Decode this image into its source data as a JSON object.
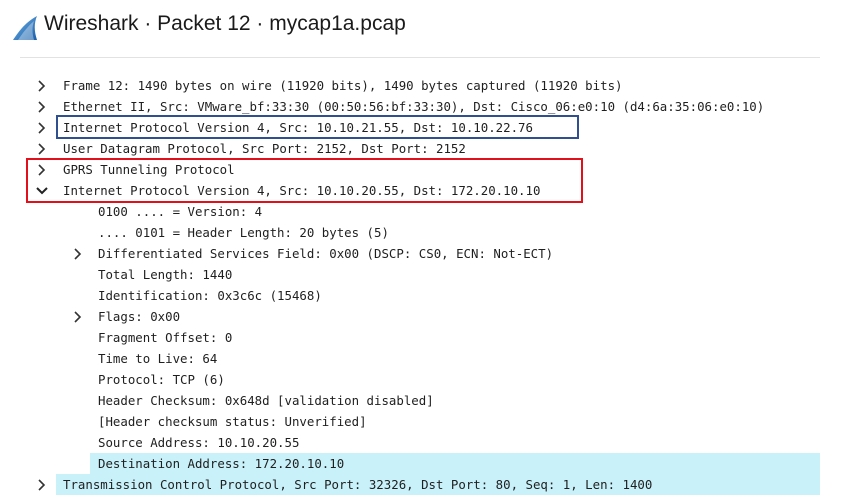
{
  "window": {
    "title": "Wireshark · Packet 12 · mycap1a.pcap",
    "app_icon": "wireshark-fin-icon",
    "accent_color": "#1b5fa8"
  },
  "tree": {
    "rows": [
      {
        "id": "frame",
        "text": "Frame 12: 1490 bytes on wire (11920 bits), 1490 bytes captured (11920 bits)",
        "state": "collapsed"
      },
      {
        "id": "ethernet",
        "text": "Ethernet II, Src: VMware_bf:33:30 (00:50:56:bf:33:30), Dst: Cisco_06:e0:10 (d4:6a:35:06:e0:10)",
        "state": "collapsed"
      },
      {
        "id": "ipv4-outer",
        "text": "Internet Protocol Version 4, Src: 10.10.21.55, Dst: 10.10.22.76",
        "state": "collapsed"
      },
      {
        "id": "udp",
        "text": "User Datagram Protocol, Src Port: 2152, Dst Port: 2152",
        "state": "collapsed"
      },
      {
        "id": "gtp",
        "text": "GPRS Tunneling Protocol",
        "state": "collapsed"
      },
      {
        "id": "ipv4-inner",
        "text": "Internet Protocol Version 4, Src: 10.10.20.55, Dst: 172.20.10.10",
        "state": "expanded"
      },
      {
        "id": "version",
        "text": "0100 .... = Version: 4",
        "state": "leaf"
      },
      {
        "id": "header-length",
        "text": ".... 0101 = Header Length: 20 bytes (5)",
        "state": "leaf"
      },
      {
        "id": "dsfield",
        "text": "Differentiated Services Field: 0x00 (DSCP: CS0, ECN: Not-ECT)",
        "state": "collapsed"
      },
      {
        "id": "total-length",
        "text": "Total Length: 1440",
        "state": "leaf"
      },
      {
        "id": "identification",
        "text": "Identification: 0x3c6c (15468)",
        "state": "leaf"
      },
      {
        "id": "flags",
        "text": "Flags: 0x00",
        "state": "collapsed"
      },
      {
        "id": "fragment-offset",
        "text": "Fragment Offset: 0",
        "state": "leaf"
      },
      {
        "id": "ttl",
        "text": "Time to Live: 64",
        "state": "leaf"
      },
      {
        "id": "protocol",
        "text": "Protocol: TCP (6)",
        "state": "leaf"
      },
      {
        "id": "checksum",
        "text": "Header Checksum: 0x648d [validation disabled]",
        "state": "leaf"
      },
      {
        "id": "checksum-status",
        "text": "[Header checksum status: Unverified]",
        "state": "leaf"
      },
      {
        "id": "src-address",
        "text": "Source Address: 10.10.20.55",
        "state": "leaf"
      },
      {
        "id": "dst-address",
        "text": "Destination Address: 172.20.10.10",
        "state": "selected"
      },
      {
        "id": "tcp",
        "text": "Transmission Control Protocol, Src Port: 32326, Dst Port: 80, Seq: 1, Len: 1400",
        "state": "collapsed"
      }
    ]
  },
  "annotations": {
    "blue_box_color": "#2f4f8f",
    "red_box_color": "#e2101b"
  }
}
